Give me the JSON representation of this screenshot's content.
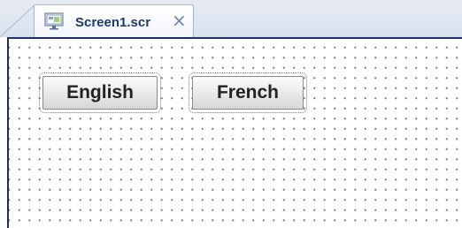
{
  "tab": {
    "icon": "screen-icon",
    "title": "Screen1.scr",
    "close_glyph": "×"
  },
  "canvas": {
    "buttons": [
      {
        "label": "English"
      },
      {
        "label": "French"
      }
    ]
  },
  "colors": {
    "frame_border": "#1e2f66",
    "tab_text": "#1d3b6e",
    "grid_dot": "#7f7f7f"
  }
}
